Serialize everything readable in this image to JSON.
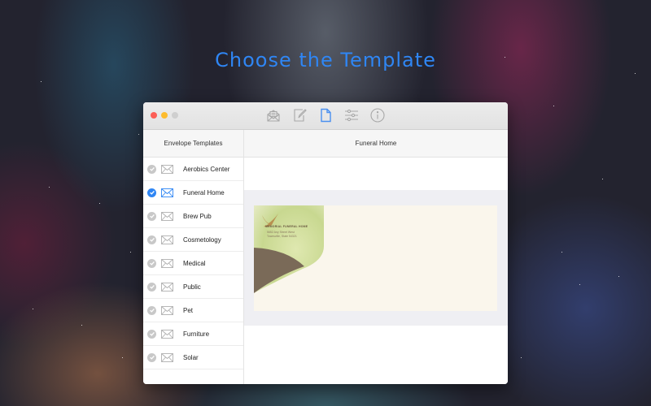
{
  "headline": "Choose the Template",
  "window": {
    "traffic_lights": {
      "close": "#fc5f57",
      "minimize": "#fdbc2e",
      "zoom": "#cfcfcf"
    },
    "toolbar": [
      {
        "icon": "envelope-letter-icon",
        "label": "Envelope",
        "active": false
      },
      {
        "icon": "edit-icon",
        "label": "Edit",
        "active": false
      },
      {
        "icon": "document-icon",
        "label": "Templates",
        "active": true
      },
      {
        "icon": "sliders-icon",
        "label": "Settings",
        "active": false
      },
      {
        "icon": "info-icon",
        "label": "Info",
        "active": false
      }
    ]
  },
  "sidebar": {
    "header": "Envelope Templates",
    "items": [
      {
        "label": "Aerobics Center",
        "selected": false
      },
      {
        "label": "Funeral Home",
        "selected": true
      },
      {
        "label": "Brew Pub",
        "selected": false
      },
      {
        "label": "Cosmetology",
        "selected": false
      },
      {
        "label": "Medical",
        "selected": false
      },
      {
        "label": "Public",
        "selected": false
      },
      {
        "label": "Pet",
        "selected": false
      },
      {
        "label": "Furniture",
        "selected": false
      },
      {
        "label": "Solar",
        "selected": false
      }
    ]
  },
  "main": {
    "header": "Funeral Home",
    "envelope": {
      "company": "MEMORIAL FUNERAL HOME",
      "address_line1": "5652 Any Street West",
      "address_line2": "Townsville, State 54321"
    }
  },
  "colors": {
    "accent": "#2f86f4",
    "inactive_check": "#c8c8c8",
    "envelope_brown": "#7a6a58",
    "envelope_paper": "#faf6ec"
  }
}
